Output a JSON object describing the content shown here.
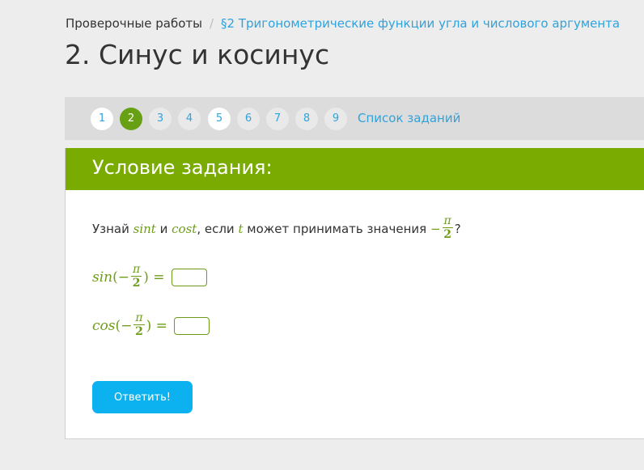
{
  "breadcrumb": {
    "root": "Проверочные работы",
    "separator": "/",
    "section": "§2 Тригонометрические функции угла и числового аргумента"
  },
  "page_title": "2. Синус и косинус",
  "task_nav": {
    "items": [
      {
        "label": "1",
        "state": "done"
      },
      {
        "label": "2",
        "state": "current"
      },
      {
        "label": "3",
        "state": "pending"
      },
      {
        "label": "4",
        "state": "pending"
      },
      {
        "label": "5",
        "state": "done"
      },
      {
        "label": "6",
        "state": "pending"
      },
      {
        "label": "7",
        "state": "pending"
      },
      {
        "label": "8",
        "state": "pending"
      },
      {
        "label": "9",
        "state": "pending"
      }
    ],
    "list_link": "Список заданий"
  },
  "task": {
    "header": "Условие задания:",
    "question": {
      "part1": "Узнай",
      "sint": "sint",
      "and": "и",
      "cost": "cost",
      "part2": ", если",
      "t": "t",
      "part3": "может принимать значения",
      "minus": "−",
      "frac_num": "π",
      "frac_den": "2",
      "end": "?"
    },
    "equations": [
      {
        "func": "sin",
        "open": "(",
        "minus": "−",
        "num": "π",
        "den": "2",
        "close": ")",
        "equals": "=",
        "value": "",
        "placeholder": ""
      },
      {
        "func": "cos",
        "open": "(",
        "minus": "−",
        "num": "π",
        "den": "2",
        "close": ")",
        "equals": "=",
        "value": "",
        "placeholder": ""
      }
    ],
    "submit_label": "Ответить!"
  },
  "colors": {
    "accent_green": "#7aab00",
    "math_green": "#6e9c19",
    "link_blue": "#30a2dc",
    "button_blue": "#0cb2ef"
  }
}
